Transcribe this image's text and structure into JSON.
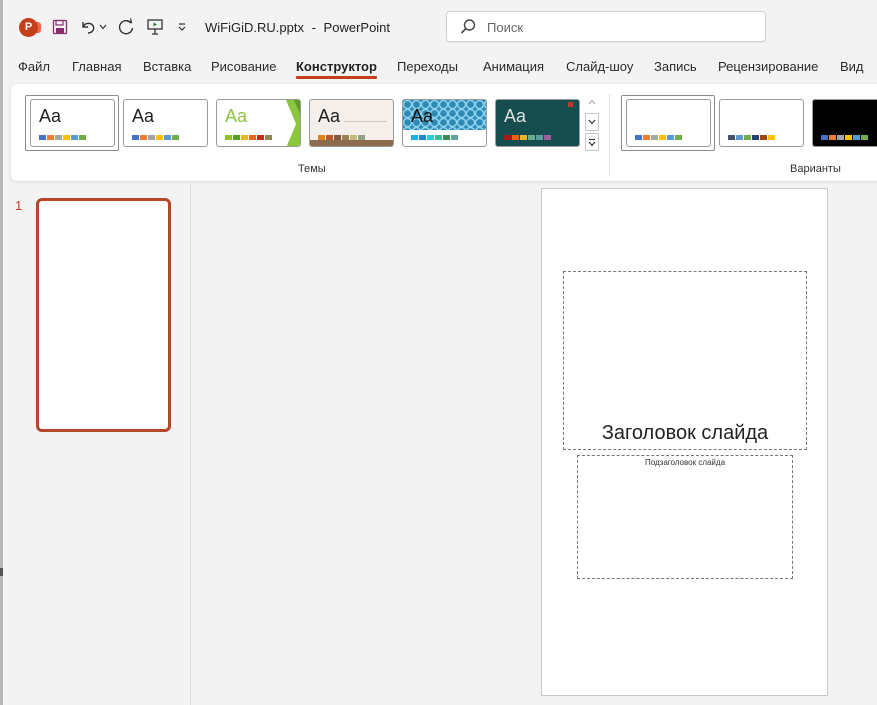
{
  "app": {
    "document_title": "WiFiGiD.RU.pptx",
    "title_separator": "-",
    "app_name": "PowerPoint",
    "logo_letter": "P"
  },
  "search": {
    "placeholder": "Поиск"
  },
  "ribbon_tabs": [
    {
      "label": "Файл"
    },
    {
      "label": "Главная"
    },
    {
      "label": "Вставка"
    },
    {
      "label": "Рисование"
    },
    {
      "label": "Конструктор",
      "active": true
    },
    {
      "label": "Переходы"
    },
    {
      "label": "Анимация"
    },
    {
      "label": "Слайд-шоу"
    },
    {
      "label": "Запись"
    },
    {
      "label": "Рецензирование"
    },
    {
      "label": "Вид"
    }
  ],
  "themes_group": {
    "label": "Темы",
    "preview_text": "Aa",
    "themes": [
      {
        "name": "office-theme",
        "bg": "#ffffff",
        "text_color": "#222222",
        "swatches": [
          "#4472c4",
          "#ed7d31",
          "#a5a5a5",
          "#ffc000",
          "#5b9bd5",
          "#70ad47"
        ]
      },
      {
        "name": "office-theme-2",
        "bg": "#ffffff",
        "text_color": "#222222",
        "swatches": [
          "#4472c4",
          "#ed7d31",
          "#a5a5a5",
          "#ffc000",
          "#5b9bd5",
          "#70ad47"
        ]
      },
      {
        "name": "facet-theme",
        "bg": "#ffffff",
        "text_color": "#8cc63f",
        "accent": "#8cc63f",
        "swatches": [
          "#90c226",
          "#54a021",
          "#e6b91e",
          "#e76618",
          "#c42f1a",
          "#918655"
        ]
      },
      {
        "name": "retrospect-theme",
        "bg": "#f4efeb",
        "text_color": "#222222",
        "swatches": [
          "#e48312",
          "#bd582c",
          "#865640",
          "#9b8357",
          "#c2bc80",
          "#94a088"
        ]
      },
      {
        "name": "pattern-theme",
        "bg": "#2c8bb5",
        "text_color": "#111111",
        "swatches": [
          "#1cade4",
          "#2683c6",
          "#27ced7",
          "#42ba97",
          "#3e8853",
          "#62a39f"
        ]
      },
      {
        "name": "dark-teal-theme",
        "bg": "#164e50",
        "text_color": "#e0e0e0",
        "swatches": [
          "#b01513",
          "#ea6312",
          "#e6b729",
          "#6aac90",
          "#5f9c9d",
          "#9e5e9b"
        ]
      }
    ]
  },
  "variants_group": {
    "label": "Варианты",
    "variants": [
      {
        "name": "variant-1",
        "bg": "#ffffff",
        "swatches": [
          "#4472c4",
          "#ed7d31",
          "#a5a5a5",
          "#ffc000",
          "#5b9bd5",
          "#70ad47"
        ]
      },
      {
        "name": "variant-2",
        "bg": "#ffffff",
        "swatches": [
          "#44546a",
          "#5b9bd5",
          "#70ad47",
          "#264478",
          "#9e480e",
          "#ffc000"
        ]
      },
      {
        "name": "variant-3",
        "bg": "#000000",
        "swatches": [
          "#4472c4",
          "#ed7d31",
          "#a5a5a5",
          "#ffc000",
          "#5b9bd5",
          "#70ad47"
        ]
      }
    ]
  },
  "slides_pane": {
    "slide_number": "1"
  },
  "slide": {
    "title_placeholder": "Заголовок слайда",
    "subtitle_placeholder": "Подзаголовок слайда"
  },
  "colors": {
    "accent": "#c43e1c",
    "thumbnail_border": "#b7472a"
  }
}
